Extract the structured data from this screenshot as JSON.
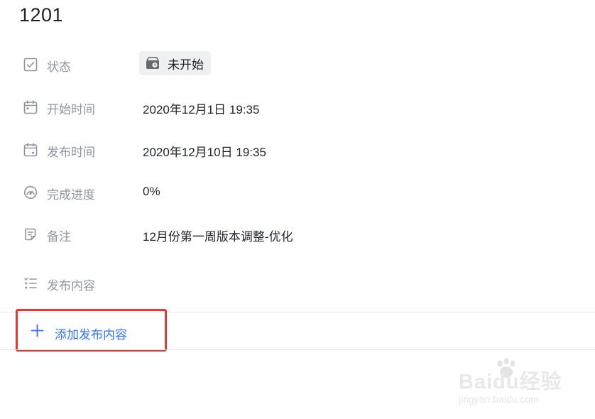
{
  "page": {
    "title": "1201"
  },
  "fields": [
    {
      "label": "状态",
      "value": "未开始",
      "icon": "checkbox-icon"
    },
    {
      "label": "开始时间",
      "value": "2020年12月1日 19:35",
      "icon": "calendar-icon"
    },
    {
      "label": "发布时间",
      "value": "2020年12月10日 19:35",
      "icon": "calendar-icon"
    },
    {
      "label": "完成进度",
      "value": "0%",
      "icon": "gauge-icon"
    },
    {
      "label": "备注",
      "value": "12月份第一周版本调整-优化",
      "icon": "note-icon"
    },
    {
      "label": "发布内容",
      "icon": "checklist-icon"
    }
  ],
  "add_content": {
    "label": "添加发布内容",
    "icon": "plus-icon"
  },
  "watermark": {
    "text": "Baidu经验",
    "subtext": "jingyan.baidu.com"
  },
  "colors": {
    "accent": "#3370ff",
    "highlight": "#e53935",
    "label": "#8f959e"
  }
}
